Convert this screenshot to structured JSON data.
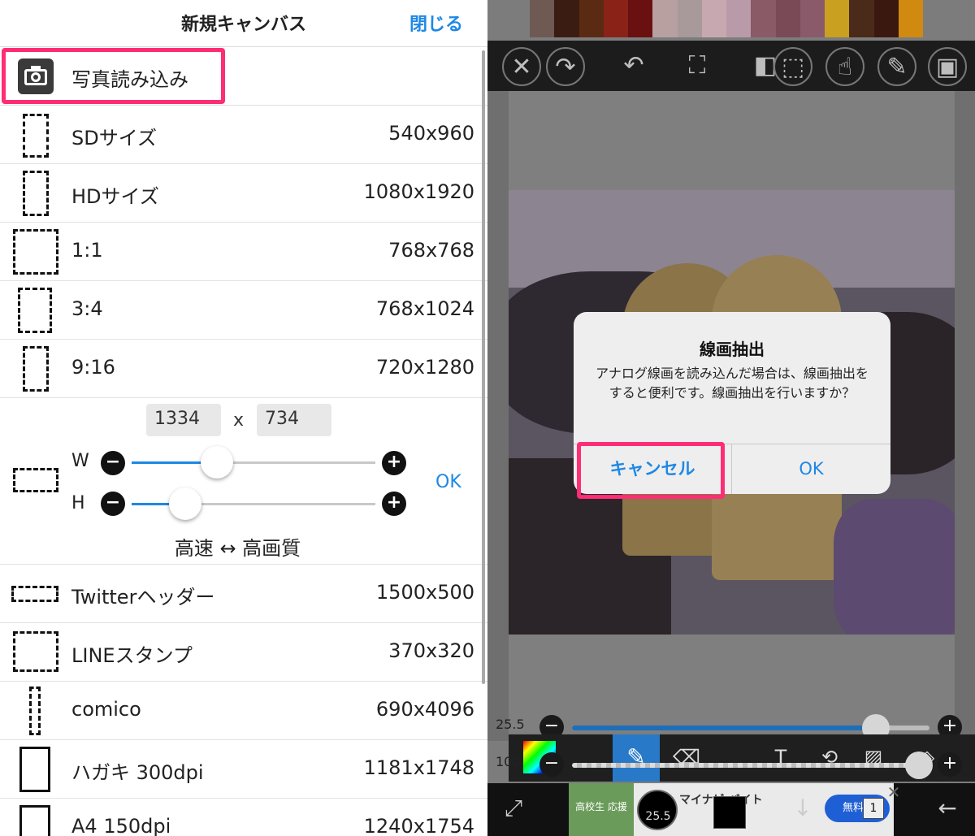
{
  "left": {
    "title": "新規キャンバス",
    "close_label": "閉じる",
    "photo_import_label": "写真読み込み",
    "presets": [
      {
        "label": "SDサイズ",
        "size": "540x960"
      },
      {
        "label": "HDサイズ",
        "size": "1080x1920"
      },
      {
        "label": "1:1",
        "size": "768x768"
      },
      {
        "label": "3:4",
        "size": "768x1024"
      },
      {
        "label": "9:16",
        "size": "720x1280"
      }
    ],
    "custom": {
      "width_value": "1334",
      "separator": "x",
      "height_value": "734",
      "w_label": "W",
      "h_label": "H",
      "minus_glyph": "−",
      "plus_glyph": "+",
      "ok_label": "OK",
      "quality_label": "高速 ↔ 高画質",
      "w_level": 0.35,
      "h_level": 0.22
    },
    "more_presets": [
      {
        "label": "Twitterヘッダー",
        "size": "1500x500"
      },
      {
        "label": "LINEスタンプ",
        "size": "370x320"
      },
      {
        "label": "comico",
        "size": "690x4096"
      },
      {
        "label": "ハガキ 300dpi",
        "size": "1181x1748"
      },
      {
        "label": "A4 150dpi",
        "size": "1240x1754"
      }
    ]
  },
  "right": {
    "palette_colors": [
      "#6e5a52",
      "#3b1c12",
      "#5a2a12",
      "#8a2218",
      "#6a1010",
      "#b8a0a0",
      "#a89a9a",
      "#c8a8b0",
      "#b89aa8",
      "#8a5a66",
      "#7a4a56",
      "#8a5a6a",
      "#c9a020",
      "#4a2a18",
      "#3a1810",
      "#d08a10"
    ],
    "dialog": {
      "title": "線画抽出",
      "message": "アナログ線画を読み込んだ場合は、線画抽出をすると便利です。線画抽出を行いますか？",
      "cancel_label": "キャンセル",
      "ok_label": "OK"
    },
    "brush_size_value": "25.5",
    "brush_size_level": 0.85,
    "opacity_value": "100",
    "opacity_level": 0.97,
    "ad": {
      "image_text": "高校生 応援",
      "text": "マイナビ バイト",
      "button_label": "無料D",
      "close_glyph": "✕"
    },
    "bottom_size_value": "25.5",
    "layer_count": "1",
    "highlight_color": "#ff2d75",
    "accent_color": "#1e88e5"
  }
}
